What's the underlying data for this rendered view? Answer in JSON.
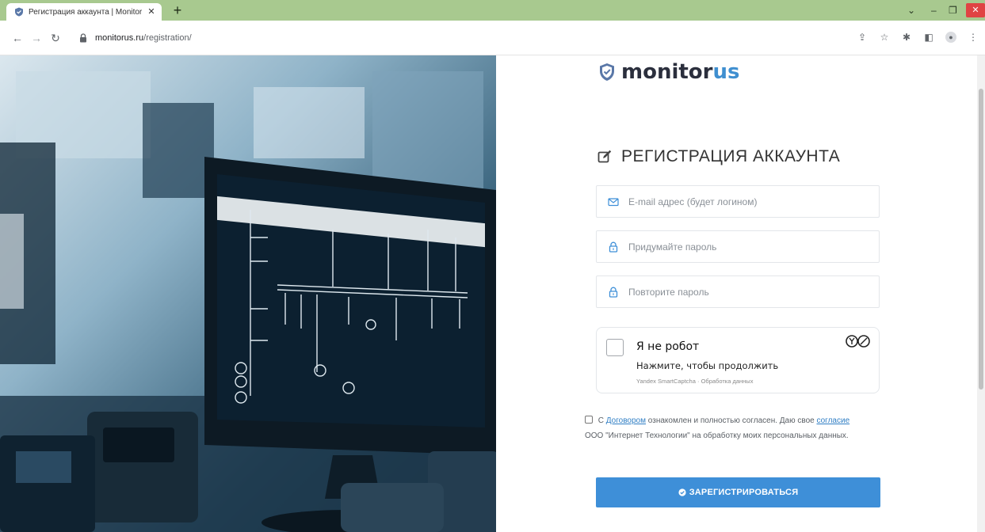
{
  "browser": {
    "tab_title": "Регистрация аккаунта | Monitor",
    "tab_close": "✕",
    "new_tab": "+",
    "url_domain": "monitorus.ru",
    "url_path": "/registration/",
    "window_controls": {
      "chevron": "⌄",
      "minimize": "–",
      "maximize": "❐",
      "close": "✕"
    }
  },
  "logo": {
    "main": "monitor",
    "accent": "us"
  },
  "form": {
    "heading": "РЕГИСТРАЦИЯ АККАУНТА",
    "email_placeholder": "E-mail адрес (будет логином)",
    "password_placeholder": "Придумайте пароль",
    "password_repeat_placeholder": "Повторите пароль",
    "captcha": {
      "title": "Я не робот",
      "subtitle": "Нажмите, чтобы продолжить",
      "footer": "Yandex SmartCaptcha · Обработка данных"
    },
    "consent": {
      "prefix": "С",
      "link1": "Договором",
      "middle": "ознакомлен и полностью согласен. Даю свое",
      "link2": "согласие",
      "suffix": "ООО \"Интернет Технологии\" на обработку моих персональных данных."
    },
    "submit_label": "ЗАРЕГИСТРИРОВАТЬСЯ"
  },
  "colors": {
    "accent": "#3e8fd8",
    "tabbar": "#a8c98f",
    "logo_accent": "#3f8fd0"
  }
}
